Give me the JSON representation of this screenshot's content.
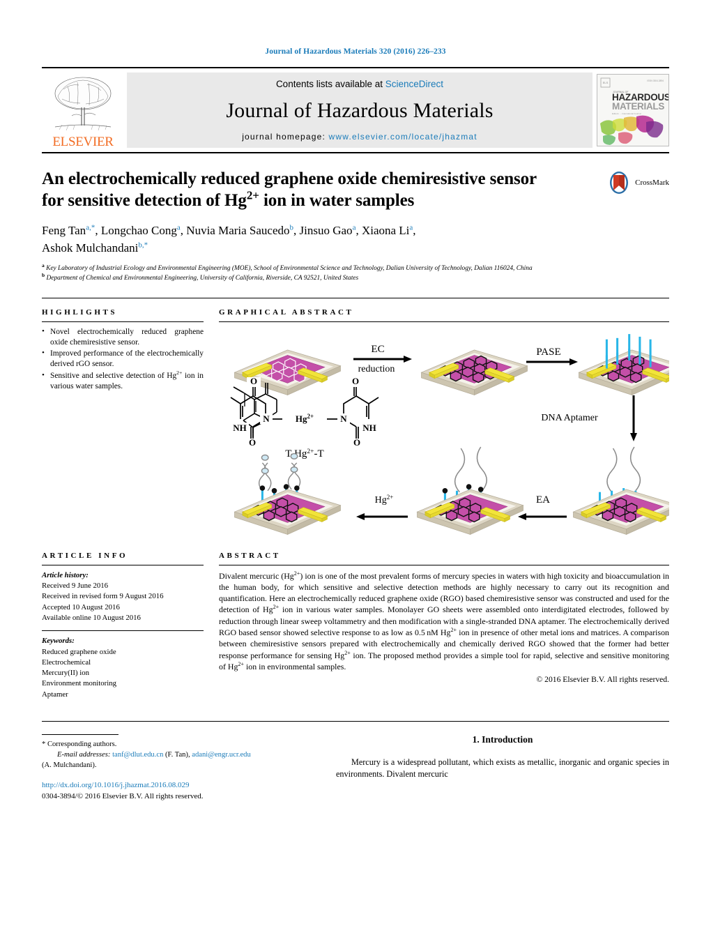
{
  "running_head": "Journal of Hazardous Materials 320 (2016) 226–233",
  "masthead": {
    "publisher": "ELSEVIER",
    "contents_prefix": "Contents lists available at ",
    "sciencedirect": "ScienceDirect",
    "journal_title": "Journal of Hazardous Materials",
    "homepage_prefix": "journal homepage: ",
    "homepage_url": "www.elsevier.com/locate/jhazmat",
    "cover_title_line1": "HAZARDOUS",
    "cover_title_line2": "MATERIALS",
    "cover_kicker": "JOURNAL OF"
  },
  "article": {
    "title_line1": "An electrochemically reduced graphene oxide chemiresistive sensor",
    "title_line2_pre": "for sensitive detection of Hg",
    "title_line2_sup": "2+",
    "title_line2_post": " ion in water samples",
    "authors": "Feng Tan, Longchao Cong, Nuvia Maria Saucedo, Jinsuo Gao, Xiaona Li, Ashok Mulchandani",
    "author_list": [
      {
        "name": "Feng Tan",
        "marks": "a,*"
      },
      {
        "name": "Longchao Cong",
        "marks": "a"
      },
      {
        "name": "Nuvia Maria Saucedo",
        "marks": "b"
      },
      {
        "name": "Jinsuo Gao",
        "marks": "a"
      },
      {
        "name": "Xiaona Li",
        "marks": "a"
      },
      {
        "name": "Ashok Mulchandani",
        "marks": "b,*"
      }
    ],
    "affiliation_a": "Key Laboratory of Industrial Ecology and Environmental Engineering (MOE), School of Environmental Science and Technology, Dalian University of Technology, Dalian 116024, China",
    "affiliation_b": "Department of Chemical and Environmental Engineering, University of California, Riverside, CA 92521, United States",
    "crossmark_label": "CrossMark"
  },
  "highlights": {
    "heading": "HIGHLIGHTS",
    "items": [
      "Novel electrochemically reduced graphene oxide chemiresistive sensor.",
      "Improved performance of the electrochemically derived rGO sensor.",
      "Sensitive and selective detection of Hg2+ ion in various water samples."
    ],
    "item_html": [
      "Novel electrochemically reduced graphene oxide chemiresistive sensor.",
      "Improved performance of the electrochemically derived rGO sensor.",
      "Sensitive and selective detection of Hg<sup>2+</sup> ion in various water samples."
    ]
  },
  "graphical_abstract": {
    "heading": "GRAPHICAL ABSTRACT",
    "labels": {
      "ec": "EC",
      "reduction": "reduction",
      "pase": "PASE",
      "dna_aptamer": "DNA Aptamer",
      "hg_ion": "Hg2+",
      "ea": "EA",
      "complex": "T-Hg2+-T",
      "atom_n_left": "N",
      "atom_n_right": "N",
      "atom_nh_left": "NH",
      "atom_nh_right": "NH",
      "atom_o": "O",
      "hg_center": "Hg2+"
    },
    "colors": {
      "electrode_gold": "#f2e43a",
      "graphene_magenta": "#c44fa8",
      "substrate_beige": "#ddd6c4",
      "linker_cyan": "#29b6e8",
      "dna_gray": "#8a8a8a"
    }
  },
  "article_info": {
    "heading": "ARTICLE INFO",
    "history_label": "Article history:",
    "history": [
      "Received 9 June 2016",
      "Received in revised form 9 August 2016",
      "Accepted 10 August 2016",
      "Available online 10 August 2016"
    ],
    "keywords_label": "Keywords:",
    "keywords": [
      "Reduced graphene oxide",
      "Electrochemical",
      "Mercury(II) ion",
      "Environment monitoring",
      "Aptamer"
    ]
  },
  "abstract": {
    "heading": "ABSTRACT",
    "body": "Divalent mercuric (Hg2+) ion is one of the most prevalent forms of mercury species in waters with high toxicity and bioaccumulation in the human body, for which sensitive and selective detection methods are highly necessary to carry out its recognition and quantification. Here an electrochemically reduced graphene oxide (RGO) based chemiresistive sensor was constructed and used for the detection of Hg2+ ion in various water samples. Monolayer GO sheets were assembled onto interdigitated electrodes, followed by reduction through linear sweep voltammetry and then modification with a single-stranded DNA aptamer. The electrochemically derived RGO based sensor showed selective response to as low as 0.5 nM Hg2+ ion in presence of other metal ions and matrices. A comparison between chemiresistive sensors prepared with electrochemically and chemically derived RGO showed that the former had better response performance for sensing Hg2+ ion. The proposed method provides a simple tool for rapid, selective and sensitive monitoring of Hg2+ ion in environmental samples.",
    "body_html": "Divalent mercuric (Hg<sup>2+</sup>) ion is one of the most prevalent forms of mercury species in waters with high toxicity and bioaccumulation in the human body, for which sensitive and selective detection methods are highly necessary to carry out its recognition and quantification. Here an electrochemically reduced graphene oxide (RGO) based chemiresistive sensor was constructed and used for the detection of Hg<sup>2+</sup> ion in various water samples. Monolayer GO sheets were assembled onto interdigitated electrodes, followed by reduction through linear sweep voltammetry and then modification with a single-stranded DNA aptamer. The electrochemically derived RGO based sensor showed selective response to as low as 0.5&#8239;nM Hg<sup>2+</sup> ion in presence of other metal ions and matrices. A comparison between chemiresistive sensors prepared with electrochemically and chemically derived RGO showed that the former had better response performance for sensing Hg<sup>2+</sup> ion. The proposed method provides a simple tool for rapid, selective and sensitive monitoring of Hg<sup>2+</sup> ion in environmental samples.",
    "copyright": "© 2016 Elsevier B.V. All rights reserved."
  },
  "footer": {
    "corresponding": "* Corresponding authors.",
    "email_label": "E-mail addresses:",
    "email1": "tanf@dlut.edu.cn",
    "email1_suffix": "(F. Tan),",
    "email2": "adani@engr.ucr.edu",
    "email2_suffix": "(A. Mulchandani).",
    "doi": "http://dx.doi.org/10.1016/j.jhazmat.2016.08.029",
    "issn": "0304-3894/© 2016 Elsevier B.V. All rights reserved."
  },
  "introduction": {
    "heading": "1. Introduction",
    "paragraph": "Mercury is a widespread pollutant, which exists as metallic, inorganic and organic species in environments. Divalent mercuric"
  }
}
